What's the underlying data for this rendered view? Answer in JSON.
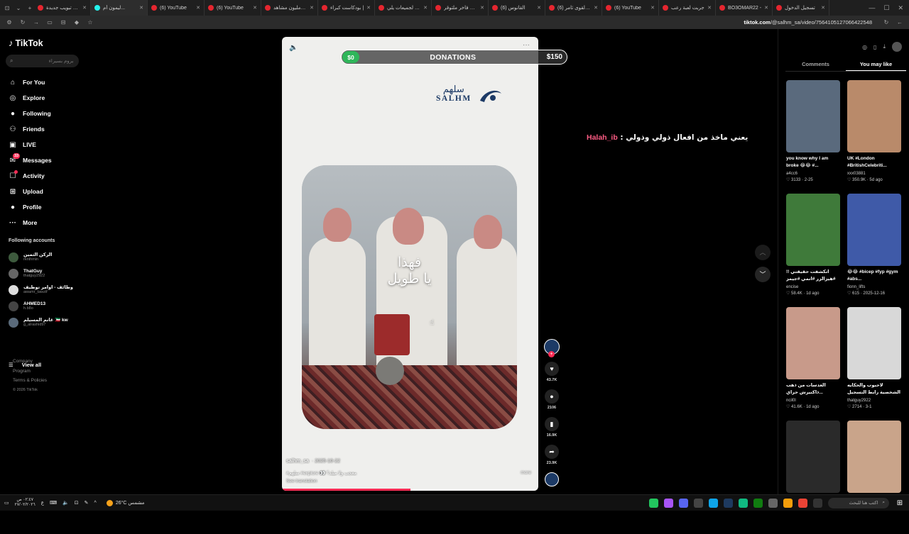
{
  "browser": {
    "tabs": [
      {
        "label": "علامة تبويب جديدة",
        "active": false,
        "favicon": "tab-icon"
      },
      {
        "label": "ليمون أم...",
        "active": true,
        "favicon": "tiktok-icon"
      },
      {
        "label": "(6) YouTube",
        "active": false,
        "favicon": "youtube-icon"
      },
      {
        "label": "(6) YouTube",
        "active": false,
        "favicon": "youtube-icon"
      },
      {
        "label": "بث 4 مليون مشاهد",
        "active": false,
        "favicon": "youtube-icon"
      },
      {
        "label": "بودكاست كبراء |",
        "active": false,
        "favicon": "youtube-icon"
      },
      {
        "label": "كتاب لجميعات يلي",
        "active": false,
        "favicon": "github-icon"
      },
      {
        "label": "حجاب فاخر ملتوقر",
        "active": false,
        "favicon": "youtube-icon"
      },
      {
        "label": "(6) القانوس",
        "active": false,
        "favicon": "youtube-icon"
      },
      {
        "label": "(6) عرفا القوى ثامر",
        "active": false,
        "favicon": "youtube-icon"
      },
      {
        "label": "(6) YouTube",
        "active": false,
        "favicon": "youtube-icon"
      },
      {
        "label": "جربت لعبة رعب",
        "active": false,
        "favicon": "youtube-icon"
      },
      {
        "label": "BO3OMAR22 -",
        "active": false,
        "favicon": "youtube-icon"
      },
      {
        "label": "تسجيل الدخول",
        "active": false,
        "favicon": "youtube-icon"
      }
    ],
    "url_domain": "tiktok.com",
    "url_path": "/@salhm_sa/video/7564105127066422548"
  },
  "sidebar": {
    "logo": "TikTok",
    "search_placeholder": "يروم بسيراء",
    "nav": [
      {
        "label": "For You",
        "icon": "home-icon",
        "glyph": "⌂"
      },
      {
        "label": "Explore",
        "icon": "compass-icon",
        "glyph": "◎"
      },
      {
        "label": "Following",
        "icon": "following-avatar-icon",
        "glyph": "●"
      },
      {
        "label": "Friends",
        "icon": "friends-icon",
        "glyph": "⚇"
      },
      {
        "label": "LIVE",
        "icon": "live-icon",
        "glyph": "▣"
      },
      {
        "label": "Messages",
        "icon": "messages-icon",
        "glyph": "✉",
        "badge": "33"
      },
      {
        "label": "Activity",
        "icon": "activity-icon",
        "glyph": "☐",
        "dot": true
      },
      {
        "label": "Upload",
        "icon": "upload-icon",
        "glyph": "⊞"
      },
      {
        "label": "Profile",
        "icon": "profile-icon",
        "glyph": "●"
      },
      {
        "label": "More",
        "icon": "more-icon",
        "glyph": "···"
      }
    ],
    "following_header": "Following accounts",
    "accounts": [
      {
        "name": "الركن الثمين",
        "handle": "rknthmin"
      },
      {
        "name": "ThatGuy",
        "handle": "thatguy2922"
      },
      {
        "name": "وظائف - اوامر توظيف",
        "handle": "awamr_tawzif"
      },
      {
        "name": "AHMED13",
        "handle": "h.b8o"
      },
      {
        "name": "غانم المسيلم 🇰🇼 kw",
        "handle": "g_alrashid97"
      }
    ],
    "view_all": "View all",
    "footer": [
      "Company",
      "Program",
      "Terms & Policies"
    ],
    "copyright": "© 2026 TikTok"
  },
  "video": {
    "brand_ar": "سلهم",
    "brand_en": "SALHM",
    "caption_line1": "فهذا",
    "caption_line2": "يا طويل",
    "author": "salhm_sa",
    "date": "· 2025-10-22",
    "description": "#سلهم #explore 👀 معجب ولا مبلد؟",
    "more": "more",
    "see_translation": "See translation",
    "progress": 0.5
  },
  "donations": {
    "left": "$0",
    "title": "DONATIONS",
    "right": "$150"
  },
  "actions": {
    "likes": "43.7K",
    "comments": "2106",
    "saves": "16.9K",
    "shares": "23.9K"
  },
  "comment_overlay": {
    "user": "Halah_ib",
    "text": ": يعني ماخذ من افعال ذولي وذولي"
  },
  "right_panel": {
    "tabs": [
      {
        "label": "Comments",
        "active": false
      },
      {
        "label": "You may like",
        "active": true
      }
    ],
    "cards": [
      {
        "title": "you know why I am broke 😂😂 #...",
        "author": "a4cc6",
        "likes": "3133",
        "date": "2-25",
        "color": "#5a6a7d"
      },
      {
        "title": "UK #London #BritishCelebriti...",
        "author": "xxx03881",
        "likes": "350.9K",
        "date": "5d ago",
        "color": "#b98a6a"
      },
      {
        "title": "انكشفت حقيقتي !! #هيزالزر #انمي #جيمز #...",
        "author": "encise",
        "likes": "58.4K",
        "date": "1d ago",
        "color": "#3f7a3a"
      },
      {
        "title": "😂😂 #bicep #fyp #gym #abs...",
        "author": "fionn_lifts",
        "likes": "615",
        "date": "2025-12-16",
        "color": "#3f5aa8"
      },
      {
        "title": "العدسات من ذهب ذاكنيرش حراي...",
        "author": "ncil0l",
        "likes": "41.6K",
        "date": "1d ago",
        "color": "#c89a8a"
      },
      {
        "title": "لاحبوب والحكايه الشخصية رابط التسجيل بالبايو S...",
        "author": "thatguy2922",
        "likes": "2714",
        "date": "3-1",
        "color": "#d8d8d8"
      },
      {
        "title": "",
        "author": "",
        "likes": "",
        "date": "",
        "color": "#2a2a2a"
      },
      {
        "title": "",
        "author": "",
        "likes": "",
        "date": "",
        "color": "#c9a48a"
      }
    ]
  },
  "taskbar": {
    "time": "٠٢:٤٧ ص",
    "date": "٢٧/٠٢/٢٠٢٦",
    "weather": "26°C مشمس",
    "search_placeholder": "اكتب هنا للبحث"
  }
}
